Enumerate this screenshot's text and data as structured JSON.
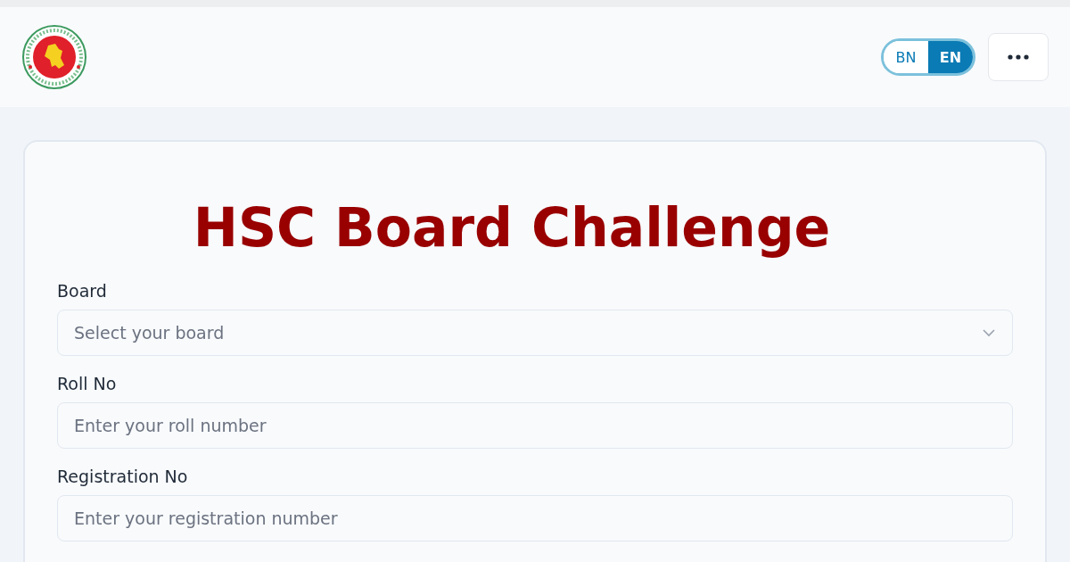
{
  "header": {
    "languages": [
      {
        "label": "BN",
        "selected": false
      },
      {
        "label": "EN",
        "selected": true
      }
    ]
  },
  "form": {
    "title": "HSC Board Challenge",
    "fields": [
      {
        "kind": "select",
        "label": "Board",
        "placeholder": "Select your board"
      },
      {
        "kind": "text",
        "label": "Roll No",
        "placeholder": "Enter your roll number"
      },
      {
        "kind": "text",
        "label": "Registration No",
        "placeholder": "Enter your registration number"
      }
    ]
  }
}
